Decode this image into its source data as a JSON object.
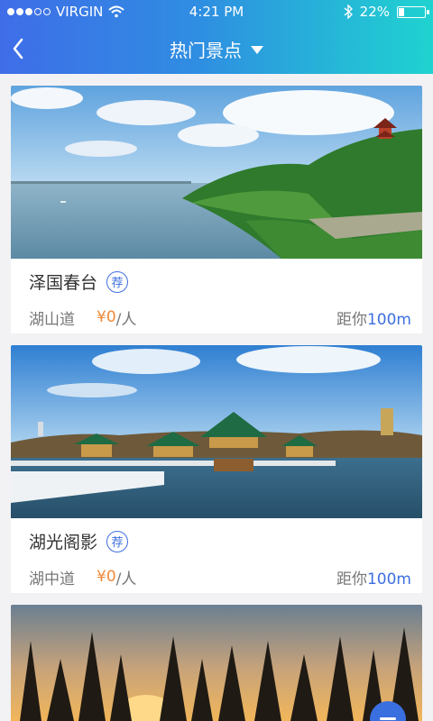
{
  "status_bar": {
    "carrier": "VIRGIN",
    "time": "4:21 PM",
    "battery": "22%",
    "battery_level": 0.22,
    "signal_dots_filled": 3,
    "signal_dots_total": 5
  },
  "nav": {
    "title": "热门景点",
    "back_icon": "chevron-left-icon",
    "dropdown_icon": "caret-down-icon"
  },
  "colors": {
    "header_gradient": [
      "#3f6de8",
      "#1fd3d0"
    ],
    "accent_blue": "#3d6fe0",
    "price_orange": "#f08a3a"
  },
  "cards": [
    {
      "name": "泽国春台",
      "badge": "荐",
      "road": "湖山道",
      "price": "¥0",
      "per": "/人",
      "dist_label": "距你",
      "dist_value": "100m"
    },
    {
      "name": "湖光阁影",
      "badge": "荐",
      "road": "湖中道",
      "price": "¥0",
      "per": "/人",
      "dist_label": "距你",
      "dist_value": "100m"
    }
  ]
}
